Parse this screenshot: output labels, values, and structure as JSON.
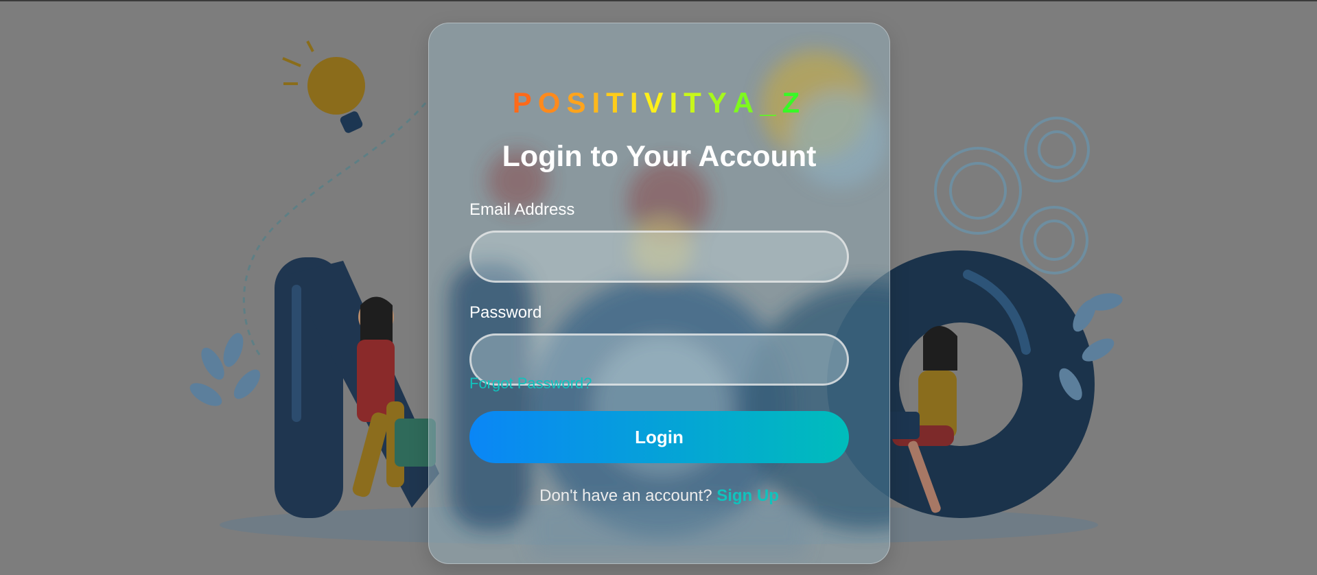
{
  "brand": {
    "letters": [
      {
        "char": "P",
        "color": "#ff6a1a"
      },
      {
        "char": "O",
        "color": "#ff8a1c"
      },
      {
        "char": "S",
        "color": "#ffa41c"
      },
      {
        "char": "I",
        "color": "#ffb81c"
      },
      {
        "char": "T",
        "color": "#ffcc1a"
      },
      {
        "char": "I",
        "color": "#ffe01a"
      },
      {
        "char": "V",
        "color": "#fff01a"
      },
      {
        "char": "I",
        "color": "#e8f51a"
      },
      {
        "char": "T",
        "color": "#c8f71a"
      },
      {
        "char": "Y",
        "color": "#a6f81c"
      },
      {
        "char": "A",
        "color": "#7ef91e"
      },
      {
        "char": "_",
        "color": "#5ef922"
      },
      {
        "char": "Z",
        "color": "#38f926"
      }
    ]
  },
  "form": {
    "title": "Login to Your Account",
    "email_label": "Email Address",
    "email_value": "",
    "password_label": "Password",
    "password_value": "",
    "forgot_label": "Forgot Password?",
    "login_label": "Login",
    "signup_prompt": "Don't have an account?",
    "signup_label": "Sign Up"
  },
  "colors": {
    "accent": "#10c3bd",
    "button_start": "#0a86f6",
    "button_end": "#00bdbb"
  }
}
